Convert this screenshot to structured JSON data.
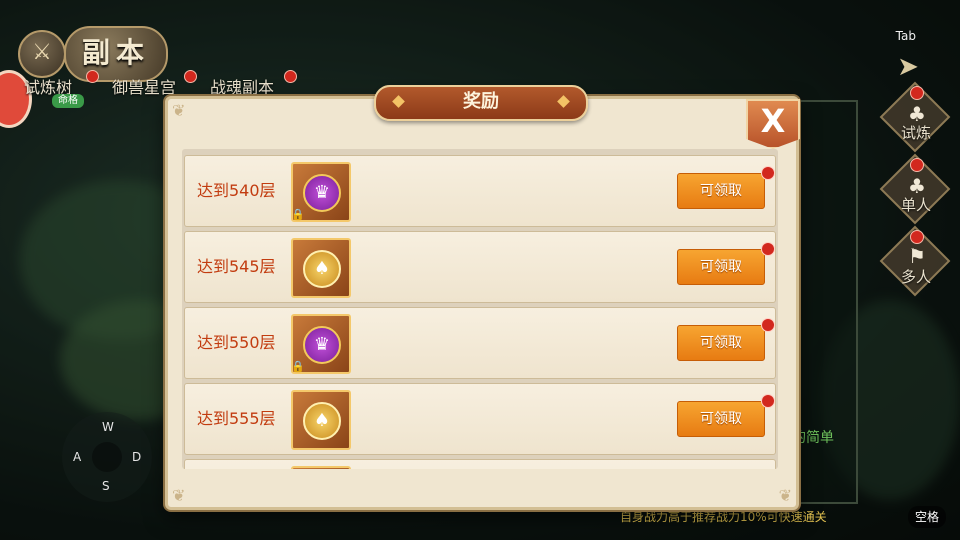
{
  "header": {
    "dungeon_title": "副本",
    "tabs": [
      {
        "label": "试炼树",
        "badge": "命格"
      },
      {
        "label": "御兽星宫"
      },
      {
        "label": "战魂副本"
      }
    ]
  },
  "right_nav": {
    "tab_key": "Tab",
    "items": [
      {
        "label": "试炼",
        "icon": "tree-icon"
      },
      {
        "label": "单人",
        "icon": "tree-icon"
      },
      {
        "label": "多人",
        "icon": "flag-icon"
      }
    ]
  },
  "side_panel": {
    "text": "的简单"
  },
  "joystick": {
    "up": "W",
    "left": "A",
    "right": "D",
    "down": "S"
  },
  "bottom": {
    "hint": "自身战力高于推荐战力10%可快速通关",
    "space_key": "空格"
  },
  "modal": {
    "title": "奖励",
    "close_label": "X",
    "rewards": [
      {
        "label": "达到540层",
        "icon": "wing-badge-icon",
        "locked": true,
        "button": "可领取"
      },
      {
        "label": "达到545层",
        "icon": "gold-coin-icon",
        "locked": false,
        "button": "可领取"
      },
      {
        "label": "达到550层",
        "icon": "wing-badge-icon",
        "locked": true,
        "button": "可领取"
      },
      {
        "label": "达到555层",
        "icon": "gold-coin-icon",
        "locked": false,
        "button": "可领取"
      }
    ]
  },
  "colors": {
    "accent_orange": "#f09020",
    "label_red": "#c23c10",
    "notification_red": "#d2281e"
  }
}
